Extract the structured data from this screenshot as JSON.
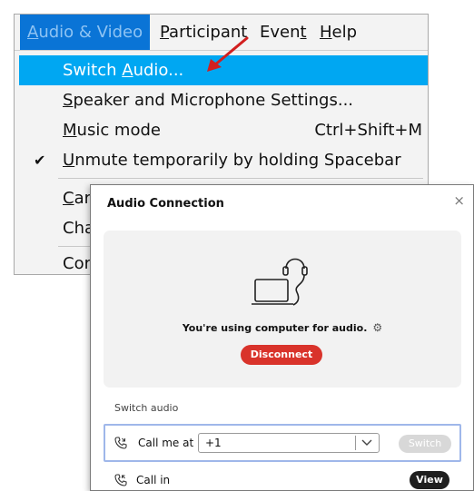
{
  "menubar": {
    "items": [
      {
        "prefix": "",
        "accel": "A",
        "rest": "udio & Video"
      },
      {
        "prefix": "",
        "accel": "P",
        "rest": "articipant"
      },
      {
        "prefix": "Even",
        "accel": "t",
        "rest": ""
      },
      {
        "prefix": "",
        "accel": "H",
        "rest": "elp"
      }
    ]
  },
  "menu": {
    "switch_audio": {
      "prefix": "Switch ",
      "accel": "A",
      "rest": "udio..."
    },
    "speaker_mic": {
      "prefix": "",
      "accel": "S",
      "rest": "peaker and Microphone Settings..."
    },
    "music_mode": {
      "prefix": "",
      "accel": "M",
      "rest": "usic mode",
      "shortcut": "Ctrl+Shift+M"
    },
    "unmute_spacebar": {
      "prefix": "",
      "accel": "U",
      "rest": "nmute temporarily by holding Spacebar",
      "check": "✔"
    },
    "partial_1": {
      "accel": "C",
      "rest": "ar"
    },
    "partial_2": {
      "rest": "Cha"
    },
    "partial_3": {
      "rest": "Cor"
    }
  },
  "dialog": {
    "title": "Audio Connection",
    "close_glyph": "×",
    "status_text": "You're using computer for audio.",
    "gear_glyph": "⚙",
    "disconnect_label": "Disconnect",
    "section_label": "Switch audio",
    "callme_label": "Call me at",
    "country_value": "+1",
    "switch_label": "Switch",
    "callin_label": "Call in",
    "view_label": "View"
  },
  "icons": {
    "headset_laptop": "laptop-headset-icon",
    "phone": "phone-icon",
    "chevron": "chevron-down-icon",
    "arrow": "annotation-arrow-icon"
  },
  "colors": {
    "menu_active": "#0a74d6",
    "row_highlight": "#00a7f2",
    "disconnect": "#d9332b",
    "arrow": "#d21f1f",
    "callme_border": "#9fb7ea"
  }
}
